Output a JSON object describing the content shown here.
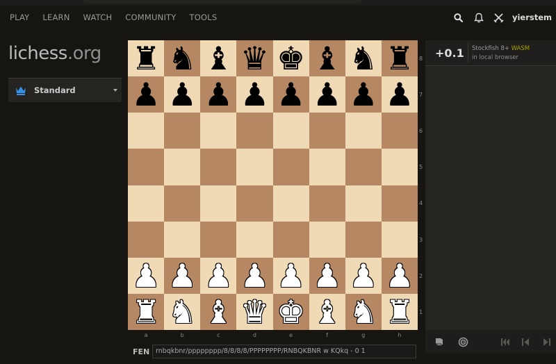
{
  "nav": {
    "items": [
      "PLAY",
      "LEARN",
      "WATCH",
      "COMMUNITY",
      "TOOLS"
    ]
  },
  "header": {
    "username": "yierstem",
    "icons": [
      "search-icon",
      "bell-icon",
      "crossed-swords-icon"
    ]
  },
  "logo": {
    "name": "lichess",
    "tld": ".org"
  },
  "variant": {
    "label": "Standard",
    "icon": "crown-icon",
    "accent": "#3692e7"
  },
  "board": {
    "light_color": "#f0d9b5",
    "dark_color": "#b58863",
    "rows": [
      [
        "br",
        "bn",
        "bb",
        "bq",
        "bk",
        "bb",
        "bn",
        "br"
      ],
      [
        "bp",
        "bp",
        "bp",
        "bp",
        "bp",
        "bp",
        "bp",
        "bp"
      ],
      [
        "",
        "",
        "",
        "",
        "",
        "",
        "",
        ""
      ],
      [
        "",
        "",
        "",
        "",
        "",
        "",
        "",
        ""
      ],
      [
        "",
        "",
        "",
        "",
        "",
        "",
        "",
        ""
      ],
      [
        "",
        "",
        "",
        "",
        "",
        "",
        "",
        ""
      ],
      [
        "wp",
        "wp",
        "wp",
        "wp",
        "wp",
        "wp",
        "wp",
        "wp"
      ],
      [
        "wr",
        "wn",
        "wb",
        "wq",
        "wk",
        "wb",
        "wn",
        "wr"
      ]
    ],
    "ranks": [
      "8",
      "7",
      "6",
      "5",
      "4",
      "3",
      "2",
      "1"
    ],
    "files": [
      "a",
      "b",
      "c",
      "d",
      "e",
      "f",
      "g",
      "h"
    ]
  },
  "fen": {
    "label": "FEN",
    "value": "rnbqkbnr/pppppppp/8/8/8/8/PPPPPPPP/RNBQKBNR w KQkq - 0 1"
  },
  "analysis": {
    "eval": "+0.1",
    "engine_name": "Stockfish 8+",
    "engine_tag": "WASM",
    "engine_sub": "in local browser"
  },
  "controls": {
    "icons": [
      "book-icon",
      "target-icon",
      "first-move-icon",
      "prev-move-icon",
      "next-move-icon"
    ]
  }
}
